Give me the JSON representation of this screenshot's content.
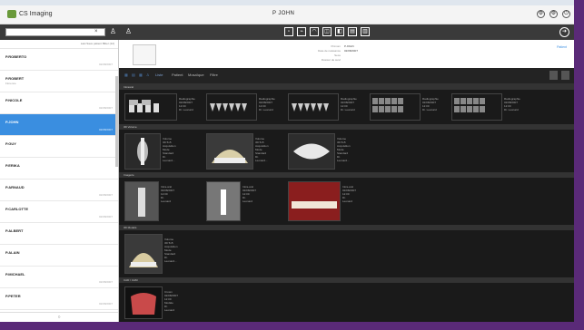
{
  "app": {
    "logo_text": "CS Imaging",
    "window_title": "P JOHN"
  },
  "window_controls": [
    "⚙",
    "⚙",
    "⏻"
  ],
  "search": {
    "value": ""
  },
  "sidebar": {
    "header_text": "Last Save patient Biber (12)",
    "patients": [
      {
        "name": "P.ROBERTO",
        "sub": "",
        "date": "02/08/2007",
        "selected": false
      },
      {
        "name": "P.ROBERT",
        "sub": "Florence",
        "date": "",
        "selected": false
      },
      {
        "name": "P.NICOLE",
        "sub": "",
        "date": "02/08/2007",
        "selected": false
      },
      {
        "name": "P.JOHN",
        "sub": "",
        "date": "02/08/2007",
        "selected": true
      },
      {
        "name": "P.GUY",
        "sub": "",
        "date": "",
        "selected": false
      },
      {
        "name": "P.ERIKA",
        "sub": "",
        "date": "",
        "selected": false
      },
      {
        "name": "P.ARNAUD",
        "sub": "",
        "date": "02/08/2007",
        "selected": false
      },
      {
        "name": "P.CARLOTTE",
        "sub": "",
        "date": "02/08/2007",
        "selected": false
      },
      {
        "name": "P.ALBERT",
        "sub": "",
        "date": "",
        "selected": false
      },
      {
        "name": "P.ALAIN",
        "sub": "",
        "date": "",
        "selected": false
      },
      {
        "name": "P.MICHAEL",
        "sub": "",
        "date": "02/08/2007",
        "selected": false
      },
      {
        "name": "P.PETER",
        "sub": "",
        "date": "02/08/2007",
        "selected": false
      }
    ],
    "footer": "○"
  },
  "info": {
    "labels": [
      "Prénom",
      "Date de naissance",
      "Sexe",
      "Dossier de suivi"
    ],
    "values": [
      "P.JOHN",
      "02/08/2007",
      "",
      ""
    ],
    "link": "Patient"
  },
  "viewer": {
    "tabs": [
      "Liste",
      "Patient",
      "Mosaïque",
      "Filtre"
    ],
    "sections": [
      {
        "title": "Intraoral",
        "tiles": [
          {
            "kind": "intraoral-fmx",
            "lines": [
              "Radiographie",
              "02/08/2007 12:00",
              "Dr. Leonard"
            ]
          },
          {
            "kind": "bitewings",
            "lines": [
              "Radiographie",
              "02/08/2007 12:00",
              "Dr. Leonard"
            ]
          },
          {
            "kind": "bitewings",
            "lines": [
              "Radiographie",
              "02/08/2007 12:00",
              "Dr. Leonard"
            ]
          },
          {
            "kind": "photo-grid",
            "lines": [
              "Radiographie",
              "02/08/2007 12:00",
              "Dr. Leonard"
            ]
          },
          {
            "kind": "photo-grid",
            "lines": [
              "Radiographie",
              "02/08/2007 12:00",
              "Dr. Leonard"
            ]
          }
        ]
      },
      {
        "title": "3D Volume",
        "tiles": [
          {
            "kind": "cbct",
            "lines": [
              "Volume 3D 5x5",
              "Acquisition Mode",
              "Standard",
              "Dr. Leonard..."
            ]
          },
          {
            "kind": "skull",
            "lines": [
              "Volume 3D 5x5",
              "Acquisition Mode",
              "Standard",
              "Dr. Leonard..."
            ]
          },
          {
            "kind": "arch",
            "lines": [
              "Volume 3D 5x5",
              "Acquisition Mode",
              "Standard",
              "Dr. Leonard..."
            ]
          }
        ]
      },
      {
        "title": "Imagerie",
        "tiles": [
          {
            "kind": "xray",
            "lines": [
              "Intra-oral",
              "02/08/2007 12:00",
              "Dr. Leonard"
            ]
          },
          {
            "kind": "xray-implant",
            "lines": [
              "Intra-oral",
              "02/08/2007 12:00",
              "Dr. Leonard"
            ]
          },
          {
            "kind": "gums",
            "lines": [
              "Intra-oral",
              "02/08/2007 12:00",
              "Dr. Leonard"
            ]
          }
        ]
      },
      {
        "title": "3D Models",
        "tiles": [
          {
            "kind": "model",
            "lines": [
              "Volume 3D 5x5",
              "Acquisition Mode",
              "Standard",
              "Dr. Leonard..."
            ]
          }
        ]
      },
      {
        "title": "CAD / CAM",
        "tiles": [
          {
            "kind": "crown",
            "lines": [
              "Crown",
              "02/08/2007 12:00",
              "Modèle",
              "Dr. Leonard"
            ]
          }
        ]
      }
    ],
    "bottom_label": "Radiographie"
  },
  "colors": {
    "accent": "#3a8ee0",
    "selection": "#3a8ee0",
    "frame": "#5a2a78",
    "viewer_bg": "#1a1a1a"
  }
}
